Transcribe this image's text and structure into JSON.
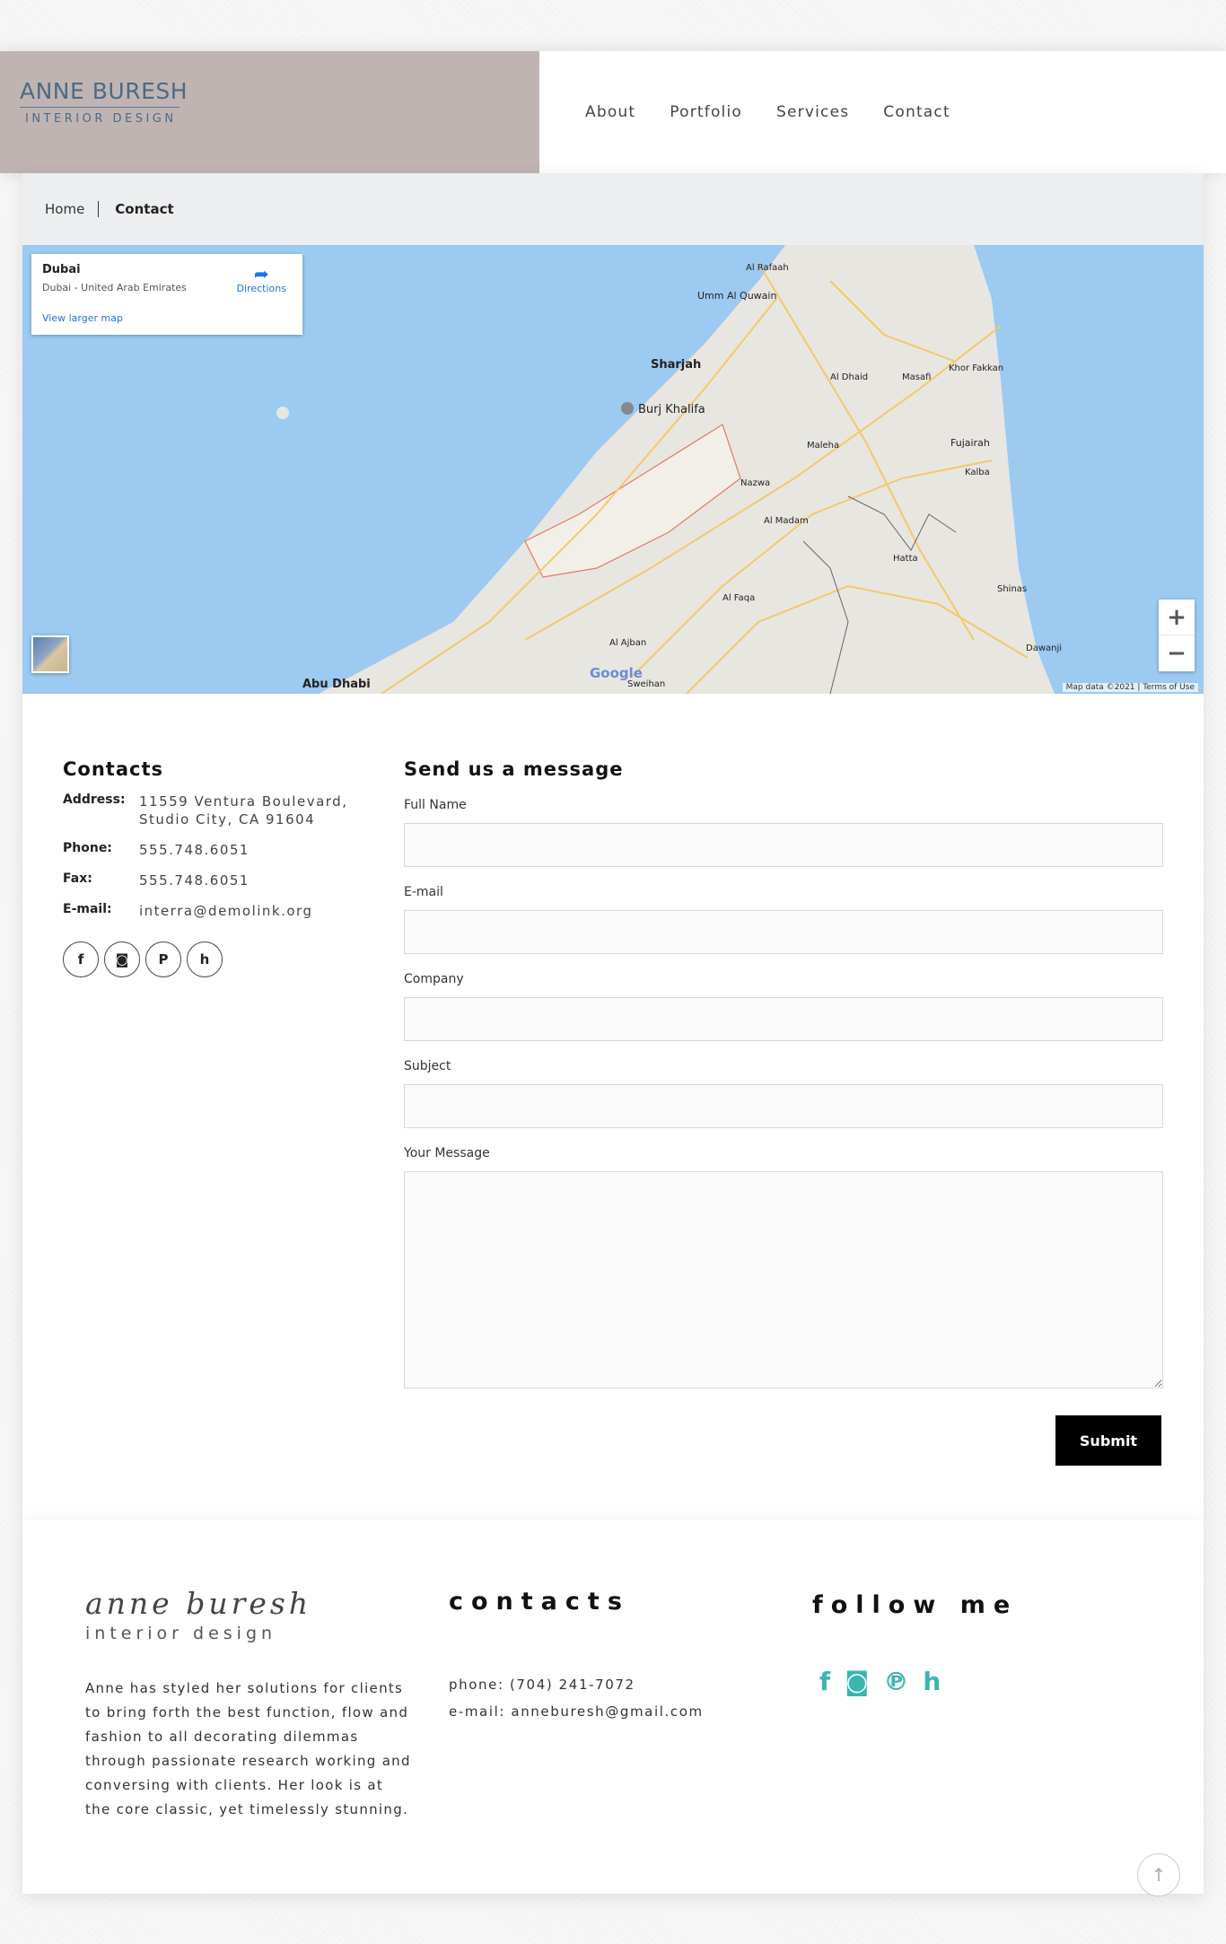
{
  "header": {
    "logo_name": "ANNE BURESH",
    "logo_sub": "INTERIOR DESIGN",
    "nav": [
      "About",
      "Portfolio",
      "Services",
      "Contact"
    ]
  },
  "breadcrumb": {
    "home": "Home",
    "current": "Contact"
  },
  "map": {
    "place_title": "Dubai",
    "place_subtitle": "Dubai - United Arab Emirates",
    "directions_label": "Directions",
    "larger_map_label": "View larger map",
    "zoom_in": "+",
    "zoom_out": "−",
    "google_label": "Google",
    "credit": "Map data ©2021 | Terms of Use",
    "cities": [
      "Sharjah",
      "Burj Khalifa",
      "Abu Dhabi",
      "Umm Al Quwain",
      "Al Rafaah",
      "Fujairah",
      "Khor Fakkan",
      "Masafi",
      "Al Dhaid",
      "Maleha",
      "Nazwa",
      "Al Madam",
      "Hatta",
      "Al Faqa",
      "Al Ajban",
      "Shinas",
      "Kalba",
      "Dawanji",
      "Sweihan"
    ]
  },
  "contacts": {
    "title": "Contacts",
    "address_label": "Address:",
    "address": "11559 Ventura Boulevard, Studio City, CA 91604",
    "phone_label": "Phone:",
    "phone": "555.748.6051",
    "fax_label": "Fax:",
    "fax": "555.748.6051",
    "email_label": "E-mail:",
    "email": "interra@demolink.org",
    "socials": [
      "facebook-icon",
      "instagram-icon",
      "pinterest-icon",
      "houzz-icon"
    ]
  },
  "form": {
    "title": "Send us a message",
    "full_name_label": "Full Name",
    "email_label": "E-mail",
    "company_label": "Company",
    "subject_label": "Subject",
    "message_label": "Your Message",
    "submit_label": "Submit"
  },
  "footer": {
    "logo_script": "anne buresh",
    "logo_sub": "interior design",
    "about": "Anne has styled her solutions for clients to bring forth the best function, flow and fashion to all decorating dilemmas through passionate research working and conversing with clients. Her look is at the core classic, yet timelessly stunning.",
    "contacts_title": "contacts",
    "phone": "phone: (704) 241-7072",
    "email": "e-mail: anneburesh@gmail.com",
    "follow_title": "follow me",
    "accent_color": "#3ab5b0"
  }
}
